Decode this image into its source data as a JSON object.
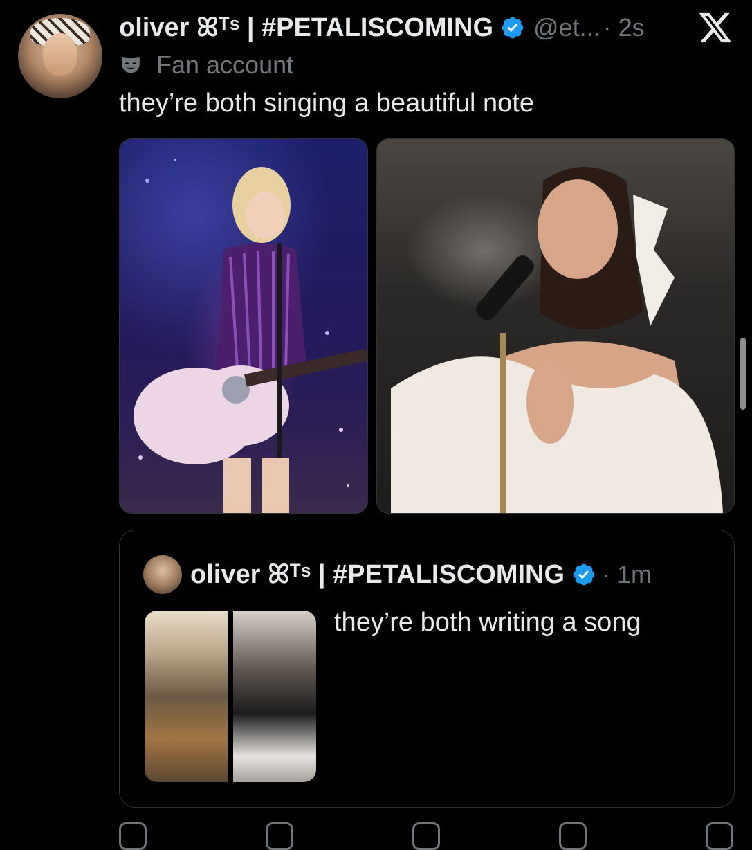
{
  "tweet": {
    "author_name": "oliver ꕤᵀˢ | #PETALISCOMING",
    "handle": "@et...",
    "time": "· 2s",
    "label": "Fan account",
    "text": "they’re both singing a beautiful note"
  },
  "quote": {
    "author_name": "oliver ꕤᵀˢ | #PETALISCOMING",
    "time": "· 1m",
    "text": "they’re both writing a song"
  },
  "icons": {
    "verified": "verified-badge-icon",
    "close": "x-logo-icon",
    "label": "theater-mask-icon"
  },
  "colors": {
    "background": "#000000",
    "text": "#e7e9ea",
    "muted": "#71767b",
    "verified": "#1d9bf0",
    "border": "#2f3336"
  }
}
